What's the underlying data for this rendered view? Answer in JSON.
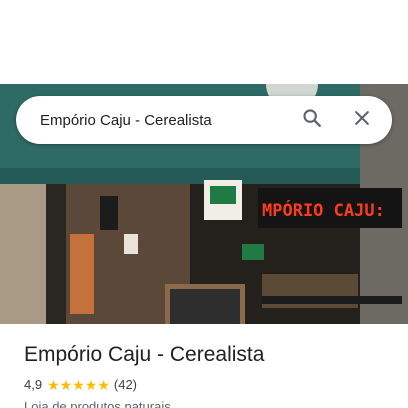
{
  "search": {
    "query": "Empório Caju - Cerealista",
    "search_icon": "search-icon",
    "close_icon": "close-icon"
  },
  "photo": {
    "led_sign_text": "MPÓRIO CAJU:",
    "led_color": "#ff3b1f",
    "awning_color": "#2f6b66"
  },
  "place": {
    "name": "Empório Caju - Cerealista",
    "rating": "4,9",
    "stars": 5,
    "reviews": "(42)",
    "category": "Loja de produtos naturais",
    "star_color": "#fbbc04"
  }
}
